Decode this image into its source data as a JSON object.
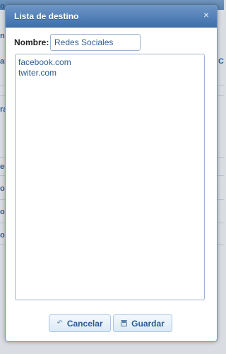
{
  "background": {
    "fragments_left": [
      "o",
      "n",
      "ar",
      "ra",
      "er",
      "o",
      "o",
      "o"
    ],
    "fragments_right": [
      "Co"
    ]
  },
  "dialog": {
    "title": "Lista de destino",
    "close_icon": "×",
    "name_label": "Nombre:",
    "name_value": "Redes Sociales",
    "list_items": [
      "facebook.com",
      "twiter.com"
    ],
    "cancel_label": "Cancelar",
    "save_label": "Guardar"
  }
}
